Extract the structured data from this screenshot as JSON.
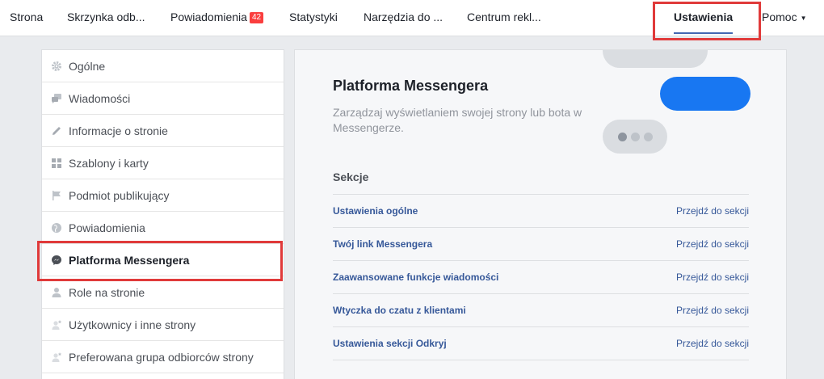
{
  "topnav": {
    "items": [
      {
        "label": "Strona"
      },
      {
        "label": "Skrzynka odb..."
      },
      {
        "label": "Powiadomienia",
        "badge": "42"
      },
      {
        "label": "Statystyki"
      },
      {
        "label": "Narzędzia do ..."
      },
      {
        "label": "Centrum rekl..."
      },
      {
        "label": "Ustawienia"
      },
      {
        "label": "Pomoc"
      }
    ]
  },
  "sidebar": {
    "items": [
      {
        "label": "Ogólne",
        "icon": "gear-icon"
      },
      {
        "label": "Wiadomości",
        "icon": "chat-bubbles-icon"
      },
      {
        "label": "Informacje o stronie",
        "icon": "pencil-icon"
      },
      {
        "label": "Szablony i karty",
        "icon": "grid-icon"
      },
      {
        "label": "Podmiot publikujący",
        "icon": "flag-icon"
      },
      {
        "label": "Powiadomienia",
        "icon": "globe-icon"
      },
      {
        "label": "Platforma Messengera",
        "icon": "messenger-icon"
      },
      {
        "label": "Role na stronie",
        "icon": "person-icon"
      },
      {
        "label": "Użytkownicy i inne strony",
        "icon": "person-star-icon"
      },
      {
        "label": "Preferowana grupa odbiorców strony",
        "icon": "person-star-icon"
      }
    ]
  },
  "main": {
    "title": "Platforma Messengera",
    "subtitle": "Zarządzaj wyświetlaniem swojej strony lub bota w Messengerze.",
    "sections_heading": "Sekcje",
    "sections": [
      {
        "label": "Ustawienia ogólne",
        "link": "Przejdź do sekcji"
      },
      {
        "label": "Twój link Messengera",
        "link": "Przejdź do sekcji"
      },
      {
        "label": "Zaawansowane funkcje wiadomości",
        "link": "Przejdź do sekcji"
      },
      {
        "label": "Wtyczka do czatu z klientami",
        "link": "Przejdź do sekcji"
      },
      {
        "label": "Ustawienia sekcji Odkryj",
        "link": "Przejdź do sekcji"
      }
    ]
  },
  "colors": {
    "accent": "#4267b2",
    "link": "#365899",
    "messenger_blue": "#1877f2",
    "badge": "#fa3e3e",
    "highlight_box": "#e03a3a"
  }
}
